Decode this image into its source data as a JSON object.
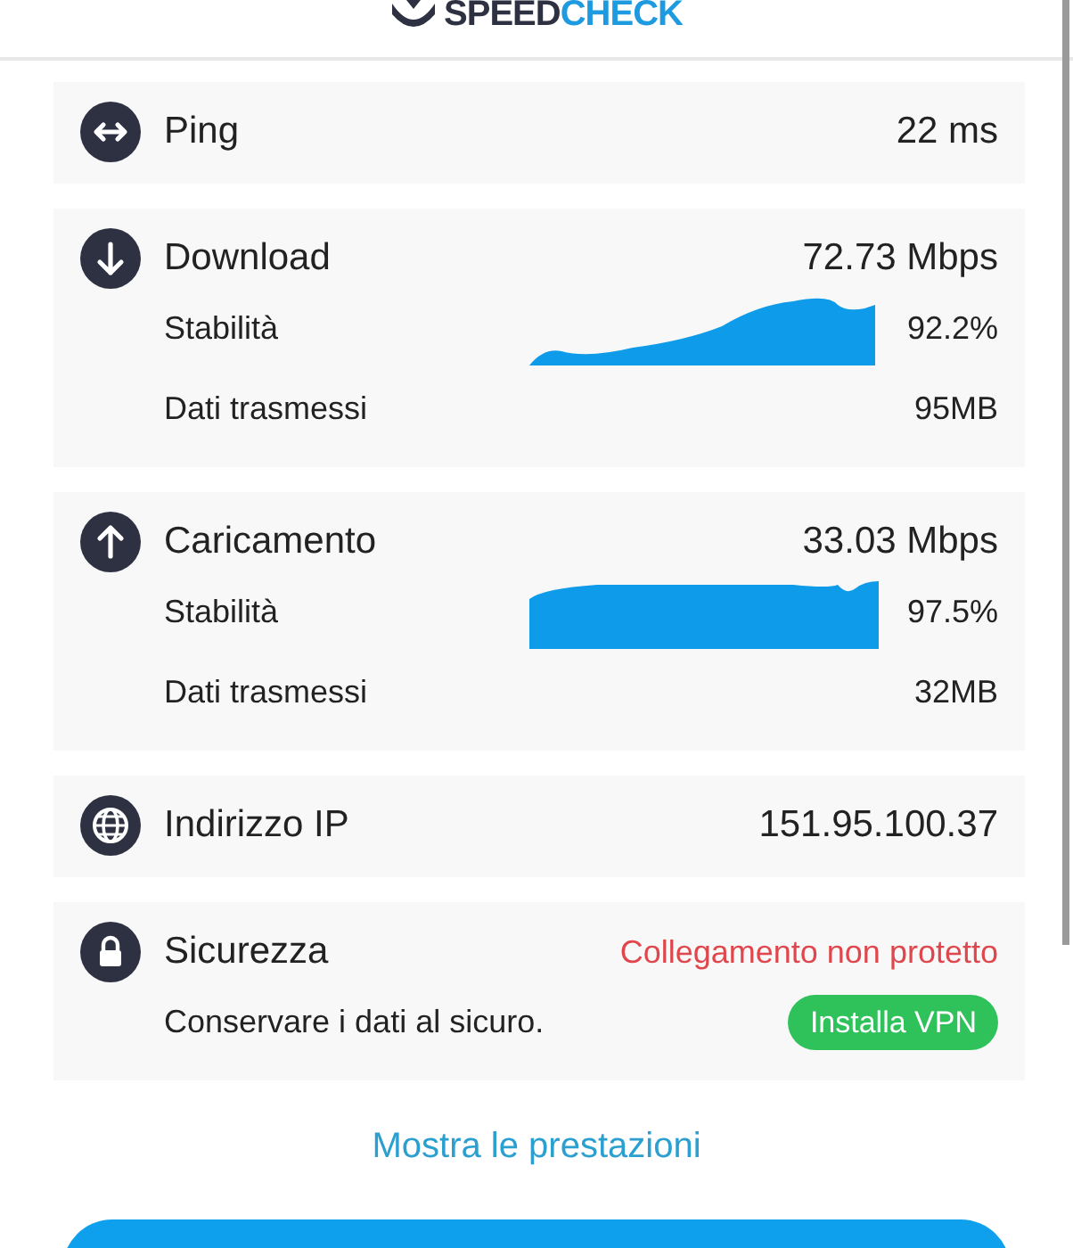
{
  "logo": {
    "first": "SPEED",
    "second": "CHECK"
  },
  "cards": [
    {
      "kind": "metric",
      "label": "Ping",
      "value": "22 ms"
    },
    {
      "kind": "metric",
      "label": "Download",
      "value": "72.73 Mbps",
      "rows": [
        {
          "kind": "graph",
          "label": "Stabilità",
          "value": "92.2%"
        },
        {
          "kind": "plain",
          "label": "Dati trasmessi",
          "value": "95MB"
        }
      ]
    },
    {
      "kind": "metric",
      "label": "Caricamento",
      "value": "33.03 Mbps",
      "rows": [
        {
          "kind": "graph",
          "label": "Stabilità",
          "value": "97.5%"
        },
        {
          "kind": "plain",
          "label": "Dati trasmessi",
          "value": "32MB"
        }
      ]
    },
    {
      "kind": "metric",
      "label": "Indirizzo IP",
      "value": "151.95.100.37"
    },
    {
      "kind": "alert",
      "label": "Sicurezza",
      "value": "Collegamento non protetto",
      "rows": [
        {
          "kind": "action",
          "label": "Conservare i dati al sicuro.",
          "button": "Installa VPN"
        }
      ]
    }
  ],
  "link": "Mostra le prestazioni"
}
